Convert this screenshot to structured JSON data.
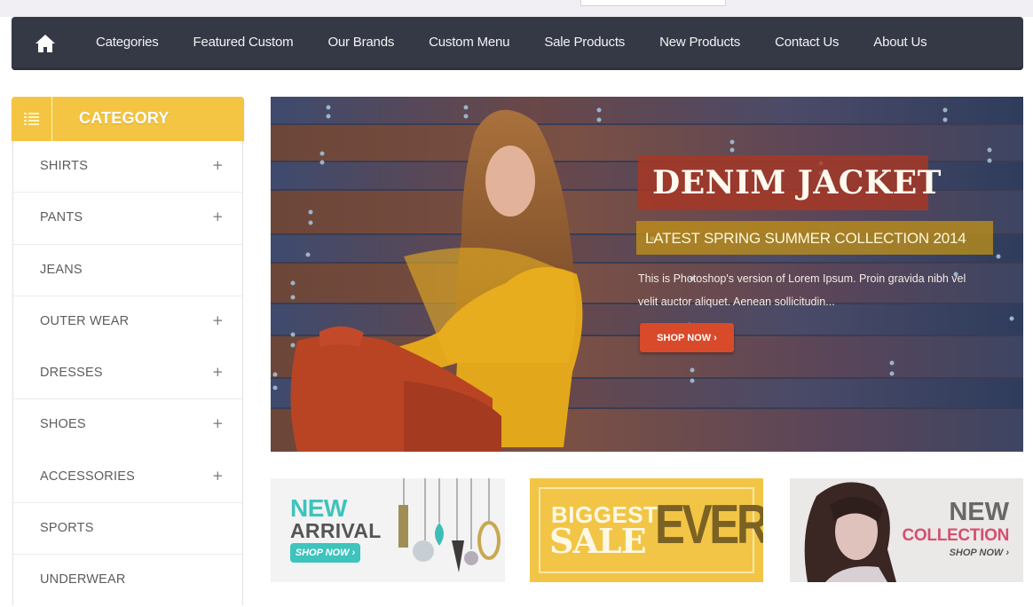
{
  "nav": {
    "home_icon": "home-icon",
    "items": [
      {
        "label": "Categories"
      },
      {
        "label": "Featured Custom"
      },
      {
        "label": "Our Brands"
      },
      {
        "label": "Custom Menu"
      },
      {
        "label": "Sale Products"
      },
      {
        "label": "New Products"
      },
      {
        "label": "Contact Us"
      },
      {
        "label": "About Us"
      }
    ]
  },
  "sidebar": {
    "title": "CATEGORY",
    "icon": "list-icon",
    "items": [
      {
        "label": "SHIRTS",
        "expand": "+"
      },
      {
        "label": "PANTS",
        "expand": "+"
      },
      {
        "label": "JEANS",
        "expand": ""
      },
      {
        "label": "OUTER WEAR",
        "expand": "+"
      },
      {
        "label": "DRESSES",
        "expand": "+"
      },
      {
        "label": "SHOES",
        "expand": "+"
      },
      {
        "label": "ACCESSORIES",
        "expand": "+"
      },
      {
        "label": "SPORTS",
        "expand": ""
      },
      {
        "label": "UNDERWEAR",
        "expand": ""
      }
    ]
  },
  "slider": {
    "title": "DENIM JACKET",
    "subtitle": "LATEST SPRING SUMMER COLLECTION 2014",
    "description": "This is Photoshop's version of Lorem Ipsum. Proin gravida nibh vel velit auctor aliquet. Aenean sollicitudin...",
    "button": "SHOP NOW ›"
  },
  "banners": [
    {
      "line1": "NEW",
      "line2": "ARRIVAL",
      "button": "SHOP NOW ›"
    },
    {
      "line1": "BIGGEST",
      "line2": "SALE",
      "line3": "EVER"
    },
    {
      "line1": "NEW",
      "line2": "COLLECTION",
      "button": "SHOP NOW ›"
    }
  ],
  "colors": {
    "nav_bg": "#353945",
    "category_yellow": "#f4c542",
    "shop_now_red": "#d84a2a",
    "teal": "#3ec3bd",
    "pink": "#d4506e"
  }
}
